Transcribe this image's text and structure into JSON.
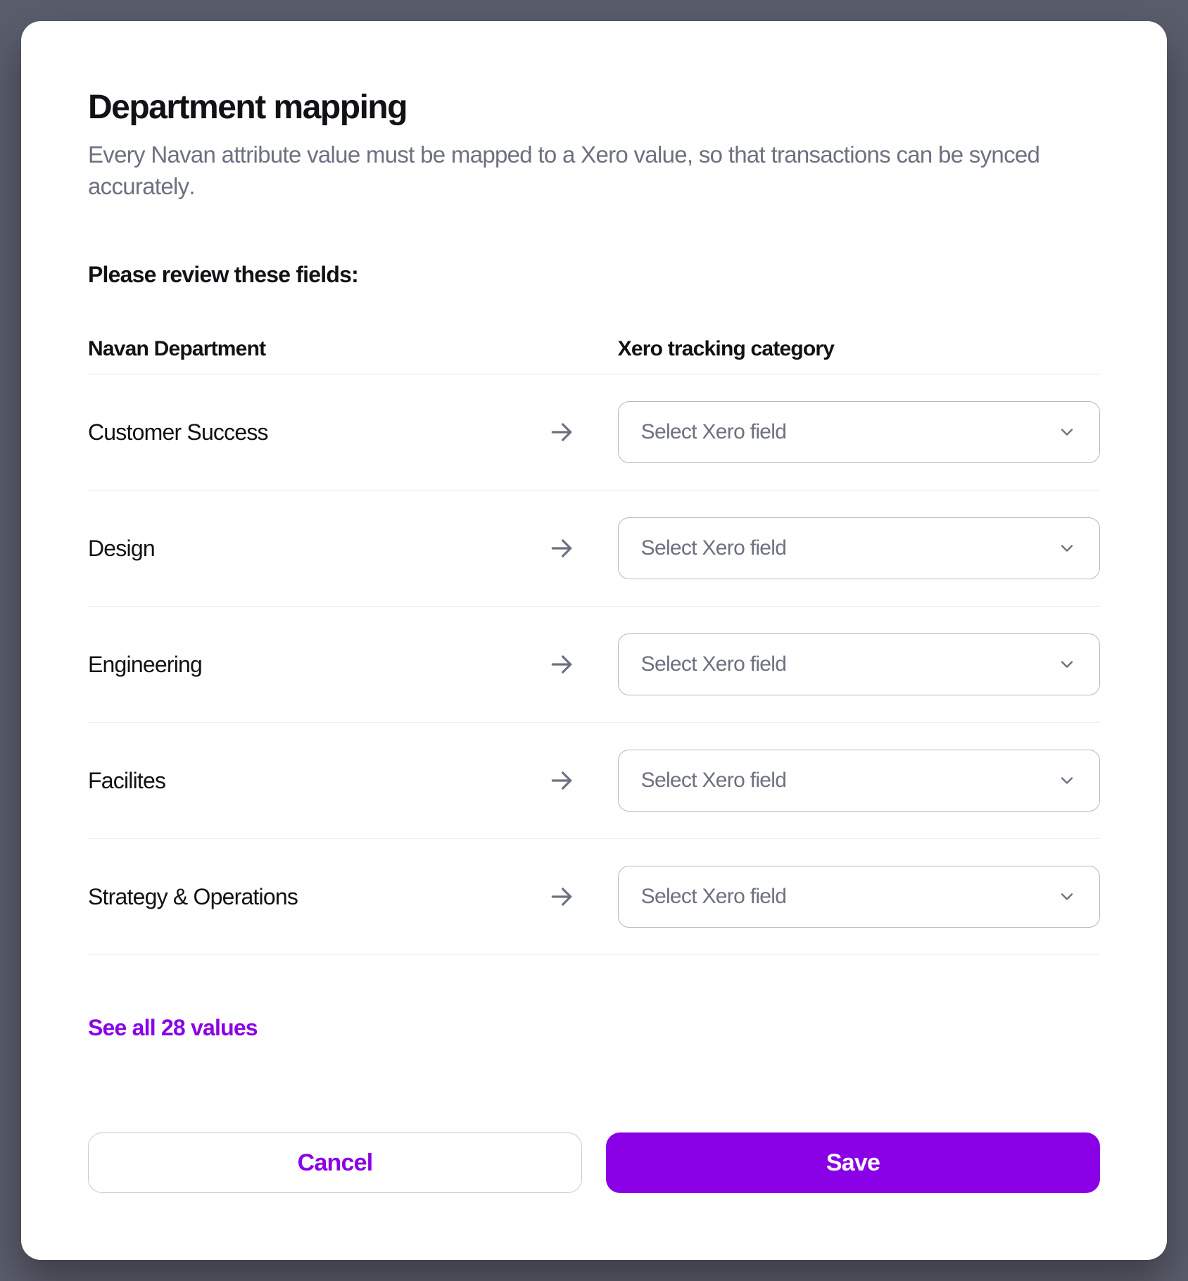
{
  "title": "Department mapping",
  "subtitle": "Every Navan attribute value must be mapped to a Xero value, so that transactions can be synced accurately.",
  "review_label": "Please review these fields:",
  "columns": {
    "source": "Navan Department",
    "target": "Xero tracking category"
  },
  "rows": [
    {
      "label": "Customer Success",
      "placeholder": "Select Xero field"
    },
    {
      "label": "Design",
      "placeholder": "Select Xero field"
    },
    {
      "label": "Engineering",
      "placeholder": "Select Xero field"
    },
    {
      "label": "Facilites",
      "placeholder": "Select Xero field"
    },
    {
      "label": "Strategy & Operations",
      "placeholder": "Select Xero field"
    }
  ],
  "see_all": "See all 28 values",
  "buttons": {
    "cancel": "Cancel",
    "save": "Save"
  },
  "colors": {
    "accent": "#8a00e6"
  }
}
